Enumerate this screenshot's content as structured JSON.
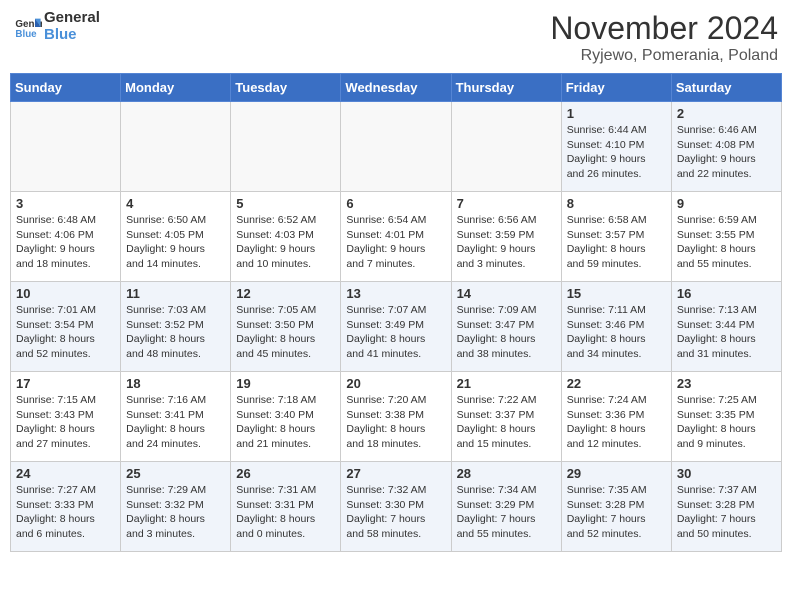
{
  "logo": {
    "text_general": "General",
    "text_blue": "Blue"
  },
  "header": {
    "month": "November 2024",
    "location": "Ryjewo, Pomerania, Poland"
  },
  "weekdays": [
    "Sunday",
    "Monday",
    "Tuesday",
    "Wednesday",
    "Thursday",
    "Friday",
    "Saturday"
  ],
  "weeks": [
    [
      {
        "day": "",
        "info": ""
      },
      {
        "day": "",
        "info": ""
      },
      {
        "day": "",
        "info": ""
      },
      {
        "day": "",
        "info": ""
      },
      {
        "day": "",
        "info": ""
      },
      {
        "day": "1",
        "info": "Sunrise: 6:44 AM\nSunset: 4:10 PM\nDaylight: 9 hours and 26 minutes."
      },
      {
        "day": "2",
        "info": "Sunrise: 6:46 AM\nSunset: 4:08 PM\nDaylight: 9 hours and 22 minutes."
      }
    ],
    [
      {
        "day": "3",
        "info": "Sunrise: 6:48 AM\nSunset: 4:06 PM\nDaylight: 9 hours and 18 minutes."
      },
      {
        "day": "4",
        "info": "Sunrise: 6:50 AM\nSunset: 4:05 PM\nDaylight: 9 hours and 14 minutes."
      },
      {
        "day": "5",
        "info": "Sunrise: 6:52 AM\nSunset: 4:03 PM\nDaylight: 9 hours and 10 minutes."
      },
      {
        "day": "6",
        "info": "Sunrise: 6:54 AM\nSunset: 4:01 PM\nDaylight: 9 hours and 7 minutes."
      },
      {
        "day": "7",
        "info": "Sunrise: 6:56 AM\nSunset: 3:59 PM\nDaylight: 9 hours and 3 minutes."
      },
      {
        "day": "8",
        "info": "Sunrise: 6:58 AM\nSunset: 3:57 PM\nDaylight: 8 hours and 59 minutes."
      },
      {
        "day": "9",
        "info": "Sunrise: 6:59 AM\nSunset: 3:55 PM\nDaylight: 8 hours and 55 minutes."
      }
    ],
    [
      {
        "day": "10",
        "info": "Sunrise: 7:01 AM\nSunset: 3:54 PM\nDaylight: 8 hours and 52 minutes."
      },
      {
        "day": "11",
        "info": "Sunrise: 7:03 AM\nSunset: 3:52 PM\nDaylight: 8 hours and 48 minutes."
      },
      {
        "day": "12",
        "info": "Sunrise: 7:05 AM\nSunset: 3:50 PM\nDaylight: 8 hours and 45 minutes."
      },
      {
        "day": "13",
        "info": "Sunrise: 7:07 AM\nSunset: 3:49 PM\nDaylight: 8 hours and 41 minutes."
      },
      {
        "day": "14",
        "info": "Sunrise: 7:09 AM\nSunset: 3:47 PM\nDaylight: 8 hours and 38 minutes."
      },
      {
        "day": "15",
        "info": "Sunrise: 7:11 AM\nSunset: 3:46 PM\nDaylight: 8 hours and 34 minutes."
      },
      {
        "day": "16",
        "info": "Sunrise: 7:13 AM\nSunset: 3:44 PM\nDaylight: 8 hours and 31 minutes."
      }
    ],
    [
      {
        "day": "17",
        "info": "Sunrise: 7:15 AM\nSunset: 3:43 PM\nDaylight: 8 hours and 27 minutes."
      },
      {
        "day": "18",
        "info": "Sunrise: 7:16 AM\nSunset: 3:41 PM\nDaylight: 8 hours and 24 minutes."
      },
      {
        "day": "19",
        "info": "Sunrise: 7:18 AM\nSunset: 3:40 PM\nDaylight: 8 hours and 21 minutes."
      },
      {
        "day": "20",
        "info": "Sunrise: 7:20 AM\nSunset: 3:38 PM\nDaylight: 8 hours and 18 minutes."
      },
      {
        "day": "21",
        "info": "Sunrise: 7:22 AM\nSunset: 3:37 PM\nDaylight: 8 hours and 15 minutes."
      },
      {
        "day": "22",
        "info": "Sunrise: 7:24 AM\nSunset: 3:36 PM\nDaylight: 8 hours and 12 minutes."
      },
      {
        "day": "23",
        "info": "Sunrise: 7:25 AM\nSunset: 3:35 PM\nDaylight: 8 hours and 9 minutes."
      }
    ],
    [
      {
        "day": "24",
        "info": "Sunrise: 7:27 AM\nSunset: 3:33 PM\nDaylight: 8 hours and 6 minutes."
      },
      {
        "day": "25",
        "info": "Sunrise: 7:29 AM\nSunset: 3:32 PM\nDaylight: 8 hours and 3 minutes."
      },
      {
        "day": "26",
        "info": "Sunrise: 7:31 AM\nSunset: 3:31 PM\nDaylight: 8 hours and 0 minutes."
      },
      {
        "day": "27",
        "info": "Sunrise: 7:32 AM\nSunset: 3:30 PM\nDaylight: 7 hours and 58 minutes."
      },
      {
        "day": "28",
        "info": "Sunrise: 7:34 AM\nSunset: 3:29 PM\nDaylight: 7 hours and 55 minutes."
      },
      {
        "day": "29",
        "info": "Sunrise: 7:35 AM\nSunset: 3:28 PM\nDaylight: 7 hours and 52 minutes."
      },
      {
        "day": "30",
        "info": "Sunrise: 7:37 AM\nSunset: 3:28 PM\nDaylight: 7 hours and 50 minutes."
      }
    ]
  ]
}
